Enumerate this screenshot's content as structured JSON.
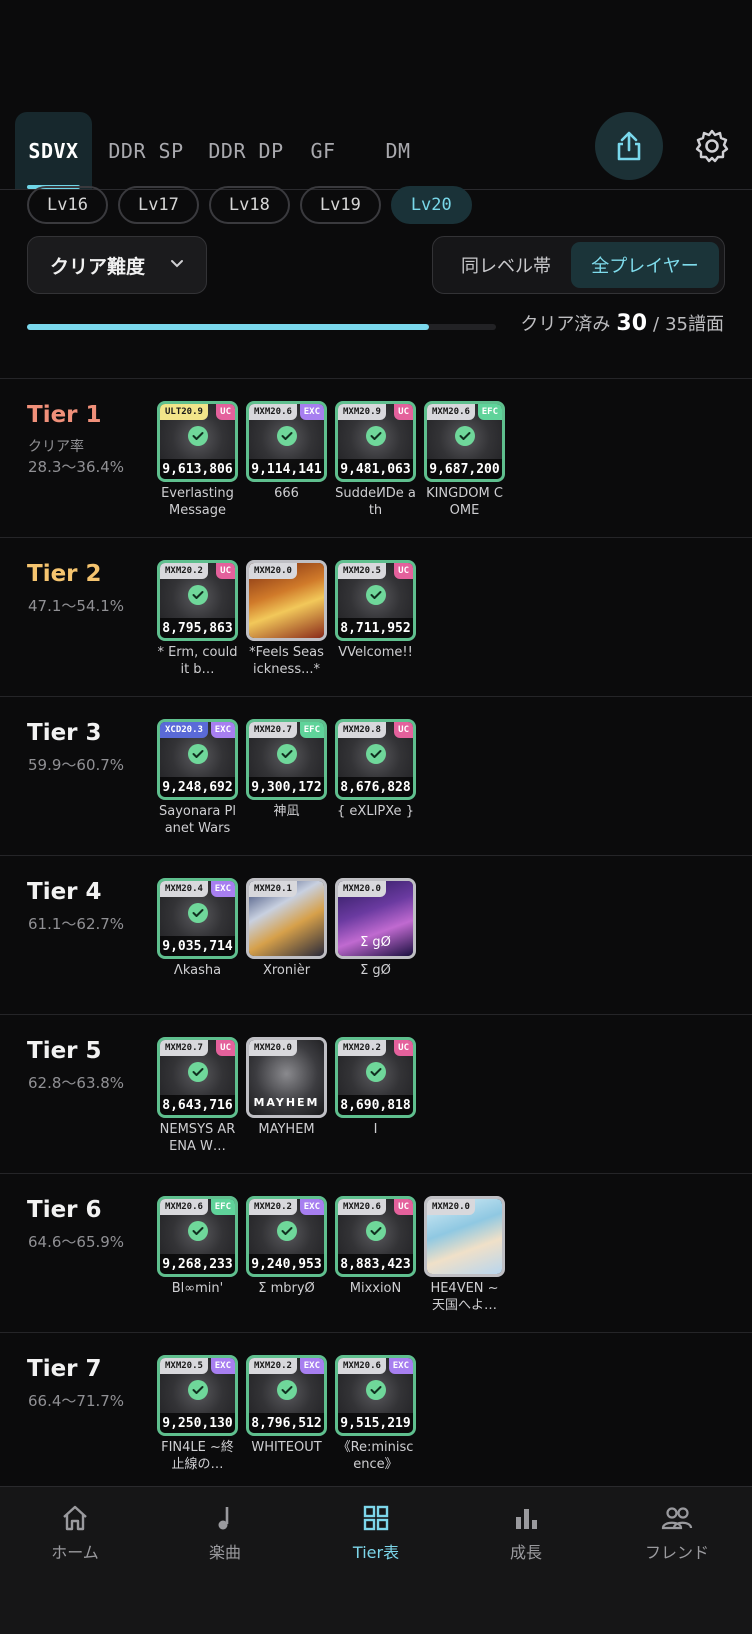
{
  "top_tabs": [
    {
      "label": "SDVX",
      "active": true
    },
    {
      "label": "DDR SP",
      "active": false
    },
    {
      "label": "DDR DP",
      "active": false
    },
    {
      "label": "GF",
      "active": false
    },
    {
      "label": "DM",
      "active": false
    }
  ],
  "icons": {
    "share": "share-icon",
    "settings": "gear-icon"
  },
  "levels": [
    "Lv16",
    "Lv17",
    "Lv18",
    "Lv19",
    "Lv20"
  ],
  "selected_level": "Lv20",
  "filter": {
    "dropdown_label": "クリア難度",
    "seg_a": "同レベル帯",
    "seg_b": "全プレイヤー",
    "selected": "全プレイヤー"
  },
  "progress": {
    "prefix": "クリア済み",
    "done": "30",
    "sep": "/",
    "total": "35譜面",
    "fraction": 0.857
  },
  "colors": {
    "accent": "#7ad8ec",
    "clear_border": "#5fbf8e",
    "uc": "#e4619c",
    "exc": "#a77ff0",
    "efc": "#5fd39a",
    "tier1": "#f0907a",
    "tier2": "#f5c46f"
  },
  "tiers": [
    {
      "title": "Tier 1",
      "sub": "クリア率",
      "rate": "28.3〜36.4%",
      "songs": [
        {
          "diff": "ULT20.9",
          "badge": "UC",
          "score": "9,613,806",
          "title": "Everlasting Message"
        },
        {
          "diff": "MXM20.6",
          "badge": "EXC",
          "score": "9,114,141",
          "title": "666"
        },
        {
          "diff": "MXM20.9",
          "badge": "UC",
          "score": "9,481,063",
          "title": "SuddeИDe ath"
        },
        {
          "diff": "MXM20.6",
          "badge": "EFC",
          "score": "9,687,200",
          "title": "KINGDOM COME"
        }
      ]
    },
    {
      "title": "Tier 2",
      "sub": "",
      "rate": "47.1〜54.1%",
      "songs": [
        {
          "diff": "MXM20.2",
          "badge": "UC",
          "score": "8,795,863",
          "title": "* Erm, could it b…"
        },
        {
          "diff": "MXM20.0",
          "badge": "",
          "score": "",
          "title": "*Feels Seas ickness...*"
        },
        {
          "diff": "MXM20.5",
          "badge": "UC",
          "score": "8,711,952",
          "title": "VVelcome!!"
        }
      ]
    },
    {
      "title": "Tier 3",
      "sub": "",
      "rate": "59.9〜60.7%",
      "songs": [
        {
          "diff": "XCD20.3",
          "badge": "EXC",
          "score": "9,248,692",
          "title": "Sayonara Planet Wars"
        },
        {
          "diff": "MXM20.7",
          "badge": "EFC",
          "score": "9,300,172",
          "title": "神凪"
        },
        {
          "diff": "MXM20.8",
          "badge": "UC",
          "score": "8,676,828",
          "title": "{ eXLIPXe }"
        }
      ]
    },
    {
      "title": "Tier 4",
      "sub": "",
      "rate": "61.1〜62.7%",
      "songs": [
        {
          "diff": "MXM20.4",
          "badge": "EXC",
          "score": "9,035,714",
          "title": "Λkasha"
        },
        {
          "diff": "MXM20.1",
          "badge": "",
          "score": "",
          "title": "Xronièr"
        },
        {
          "diff": "MXM20.0",
          "badge": "",
          "score": "",
          "title": "Σ gØ"
        }
      ]
    },
    {
      "title": "Tier 5",
      "sub": "",
      "rate": "62.8〜63.8%",
      "songs": [
        {
          "diff": "MXM20.7",
          "badge": "UC",
          "score": "8,643,716",
          "title": "NEMSYS ARENA W…"
        },
        {
          "diff": "MXM20.0",
          "badge": "",
          "score": "",
          "title": "MAYHEM"
        },
        {
          "diff": "MXM20.2",
          "badge": "UC",
          "score": "8,690,818",
          "title": "I"
        }
      ]
    },
    {
      "title": "Tier 6",
      "sub": "",
      "rate": "64.6〜65.9%",
      "songs": [
        {
          "diff": "MXM20.6",
          "badge": "EFC",
          "score": "9,268,233",
          "title": "Bl∞min'"
        },
        {
          "diff": "MXM20.2",
          "badge": "EXC",
          "score": "9,240,953",
          "title": "Σ mbryØ"
        },
        {
          "diff": "MXM20.6",
          "badge": "UC",
          "score": "8,883,423",
          "title": "MixxioN"
        },
        {
          "diff": "MXM20.0",
          "badge": "",
          "score": "",
          "title": "HE4VEN ~天国へよ…"
        }
      ]
    },
    {
      "title": "Tier 7",
      "sub": "",
      "rate": "66.4〜71.7%",
      "songs": [
        {
          "diff": "MXM20.5",
          "badge": "EXC",
          "score": "9,250,130",
          "title": "FIN4LE ~終止線の…"
        },
        {
          "diff": "MXM20.2",
          "badge": "EXC",
          "score": "8,796,512",
          "title": "WHITEOUT"
        },
        {
          "diff": "MXM20.6",
          "badge": "EXC",
          "score": "9,515,219",
          "title": "《Re:minisc ence》"
        }
      ]
    }
  ],
  "art_text": {
    "mayhem": "MAYHEM",
    "sigma": "Σ gØ"
  },
  "bottom_nav": [
    {
      "label": "ホーム",
      "icon": "home-icon",
      "active": false
    },
    {
      "label": "楽曲",
      "icon": "music-note-icon",
      "active": false
    },
    {
      "label": "Tier表",
      "icon": "grid-icon",
      "active": true
    },
    {
      "label": "成長",
      "icon": "bar-chart-icon",
      "active": false
    },
    {
      "label": "フレンド",
      "icon": "people-icon",
      "active": false
    }
  ]
}
